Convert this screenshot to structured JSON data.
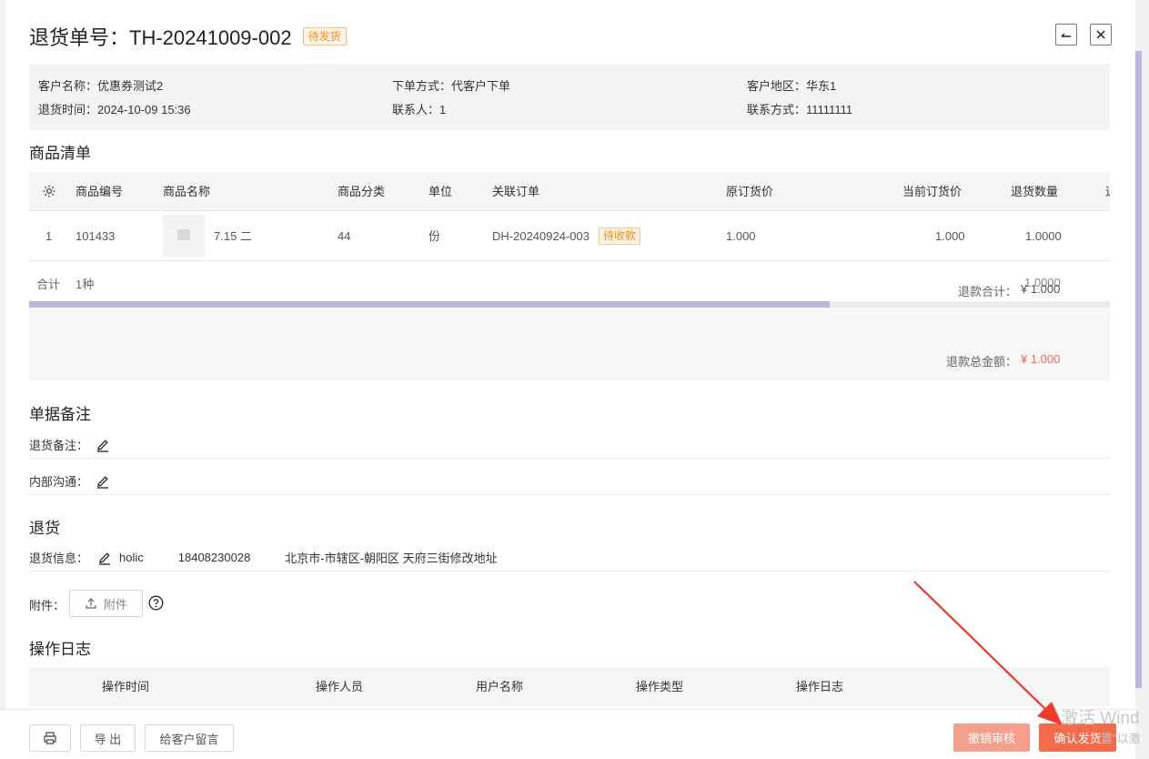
{
  "header": {
    "title": "退货单号：TH-20241009-002",
    "status": "待发货",
    "collapse_icon": "arrow-left-icon",
    "close_icon": "close-icon"
  },
  "info": {
    "customer_name": "客户名称：优惠券测试2",
    "order_method": "下单方式：代客户下单",
    "customer_region": "客户地区：华东1",
    "return_time": "退货时间：2024-10-09 15:36",
    "contact_person": "联系人：1",
    "contact_phone": "联系方式：11111111"
  },
  "goods": {
    "title": "商品清单",
    "columns": [
      "商品编号",
      "商品名称",
      "商品分类",
      "单位",
      "关联订单",
      "原订货价",
      "当前订货价",
      "退货数量",
      "退"
    ],
    "rows": [
      {
        "index": "1",
        "code": "101433",
        "name": "7.15 二",
        "category": "44",
        "unit": "份",
        "order": "DH-20240924-003",
        "order_status": "待收款",
        "original_price": "1.000",
        "current_price": "1.000",
        "return_qty": "1.0000"
      }
    ],
    "total_label": "合计",
    "total_kinds": "1种",
    "total_qty": "1.0000",
    "refund_subtotal_label": "退款合计：",
    "refund_subtotal_value": "¥ 1.000",
    "refund_total_label": "退款总金额：",
    "refund_total_value": "¥ 1.000"
  },
  "remarks": {
    "title": "单据备注",
    "return_note_label": "退货备注：",
    "internal_label": "内部沟通："
  },
  "return_section": {
    "title": "退货",
    "info_label": "退货信息：",
    "name": "holic",
    "phone": "18408230028",
    "address": "北京市-市辖区-朝阳区 天府三街修改地址",
    "attachment_label": "附件：",
    "attachment_button": "附件"
  },
  "log": {
    "title": "操作日志",
    "columns": [
      "操作时间",
      "操作人员",
      "用户名称",
      "操作类型",
      "操作日志"
    ]
  },
  "footer": {
    "export": "导 出",
    "message": "给客户留言",
    "revoke": "撤销审核",
    "confirm": "确认发货"
  },
  "watermark": {
    "line1": "激活 Wind",
    "line2": "置\"以激"
  },
  "colors": {
    "accent": "#f56c4d",
    "accent_light": "#f5a08d",
    "warning": "#fa8c16",
    "scrollbar": "#b8b8dc",
    "annotation_arrow": "#f03a2e"
  }
}
